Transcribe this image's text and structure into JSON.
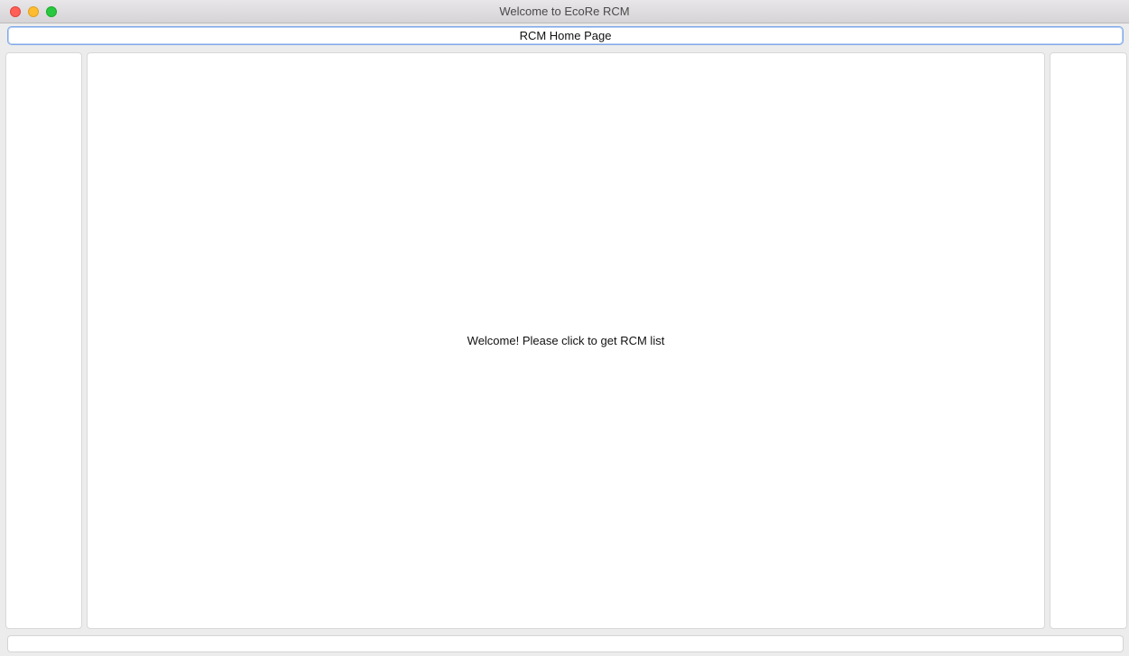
{
  "window": {
    "title": "Welcome to EcoRe RCM"
  },
  "header": {
    "home_button_label": "RCM Home Page"
  },
  "main": {
    "welcome_message": "Welcome! Please click to get RCM list"
  },
  "colors": {
    "traffic_close": "#fe5f57",
    "traffic_minimize": "#febc2e",
    "traffic_maximize": "#28c840",
    "focus_border": "#7fa8e8"
  }
}
